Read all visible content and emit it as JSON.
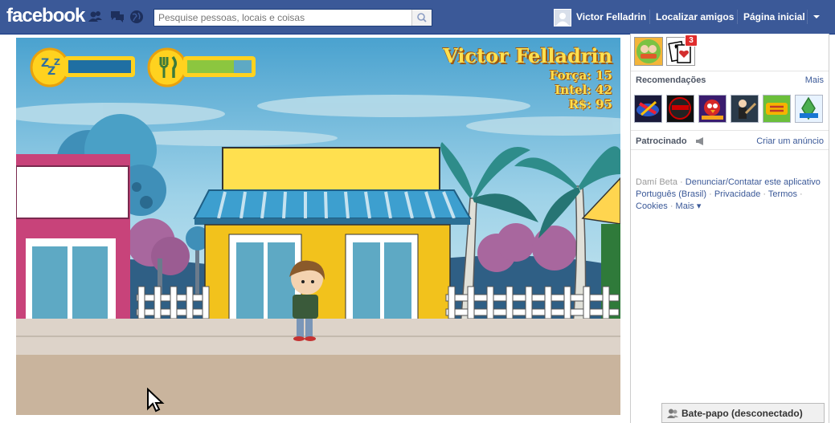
{
  "topbar": {
    "logo": "facebook",
    "search_placeholder": "Pesquise pessoas, locais e coisas",
    "user_name": "Victor Felladrin",
    "find_friends": "Localizar amigos",
    "home": "Página inicial"
  },
  "game": {
    "player_name": "Victor Felladrin",
    "strength": "Força: 15",
    "intel": "Intel: 42",
    "money": "R$: 95",
    "sleep_level": 1.0,
    "food_level": 0.73
  },
  "sidebar": {
    "notification_count": "3",
    "recommendations_title": "Recomendações",
    "more_link": "Mais",
    "sponsored_title": "Patrocinado",
    "create_ad": "Criar um anúncio",
    "app_name": "Damí Beta",
    "report": "Denunciar/Contatar este aplicativo",
    "language": "Português (Brasil)",
    "privacy": "Privacidade",
    "terms": "Termos",
    "cookies": "Cookies",
    "more_footer": "Mais"
  },
  "chat": {
    "label": "Bate-papo (desconectado)"
  },
  "colors": {
    "brand": "#3b5998",
    "hud_text": "#ffe04f",
    "sky": "#6fb5d8"
  }
}
